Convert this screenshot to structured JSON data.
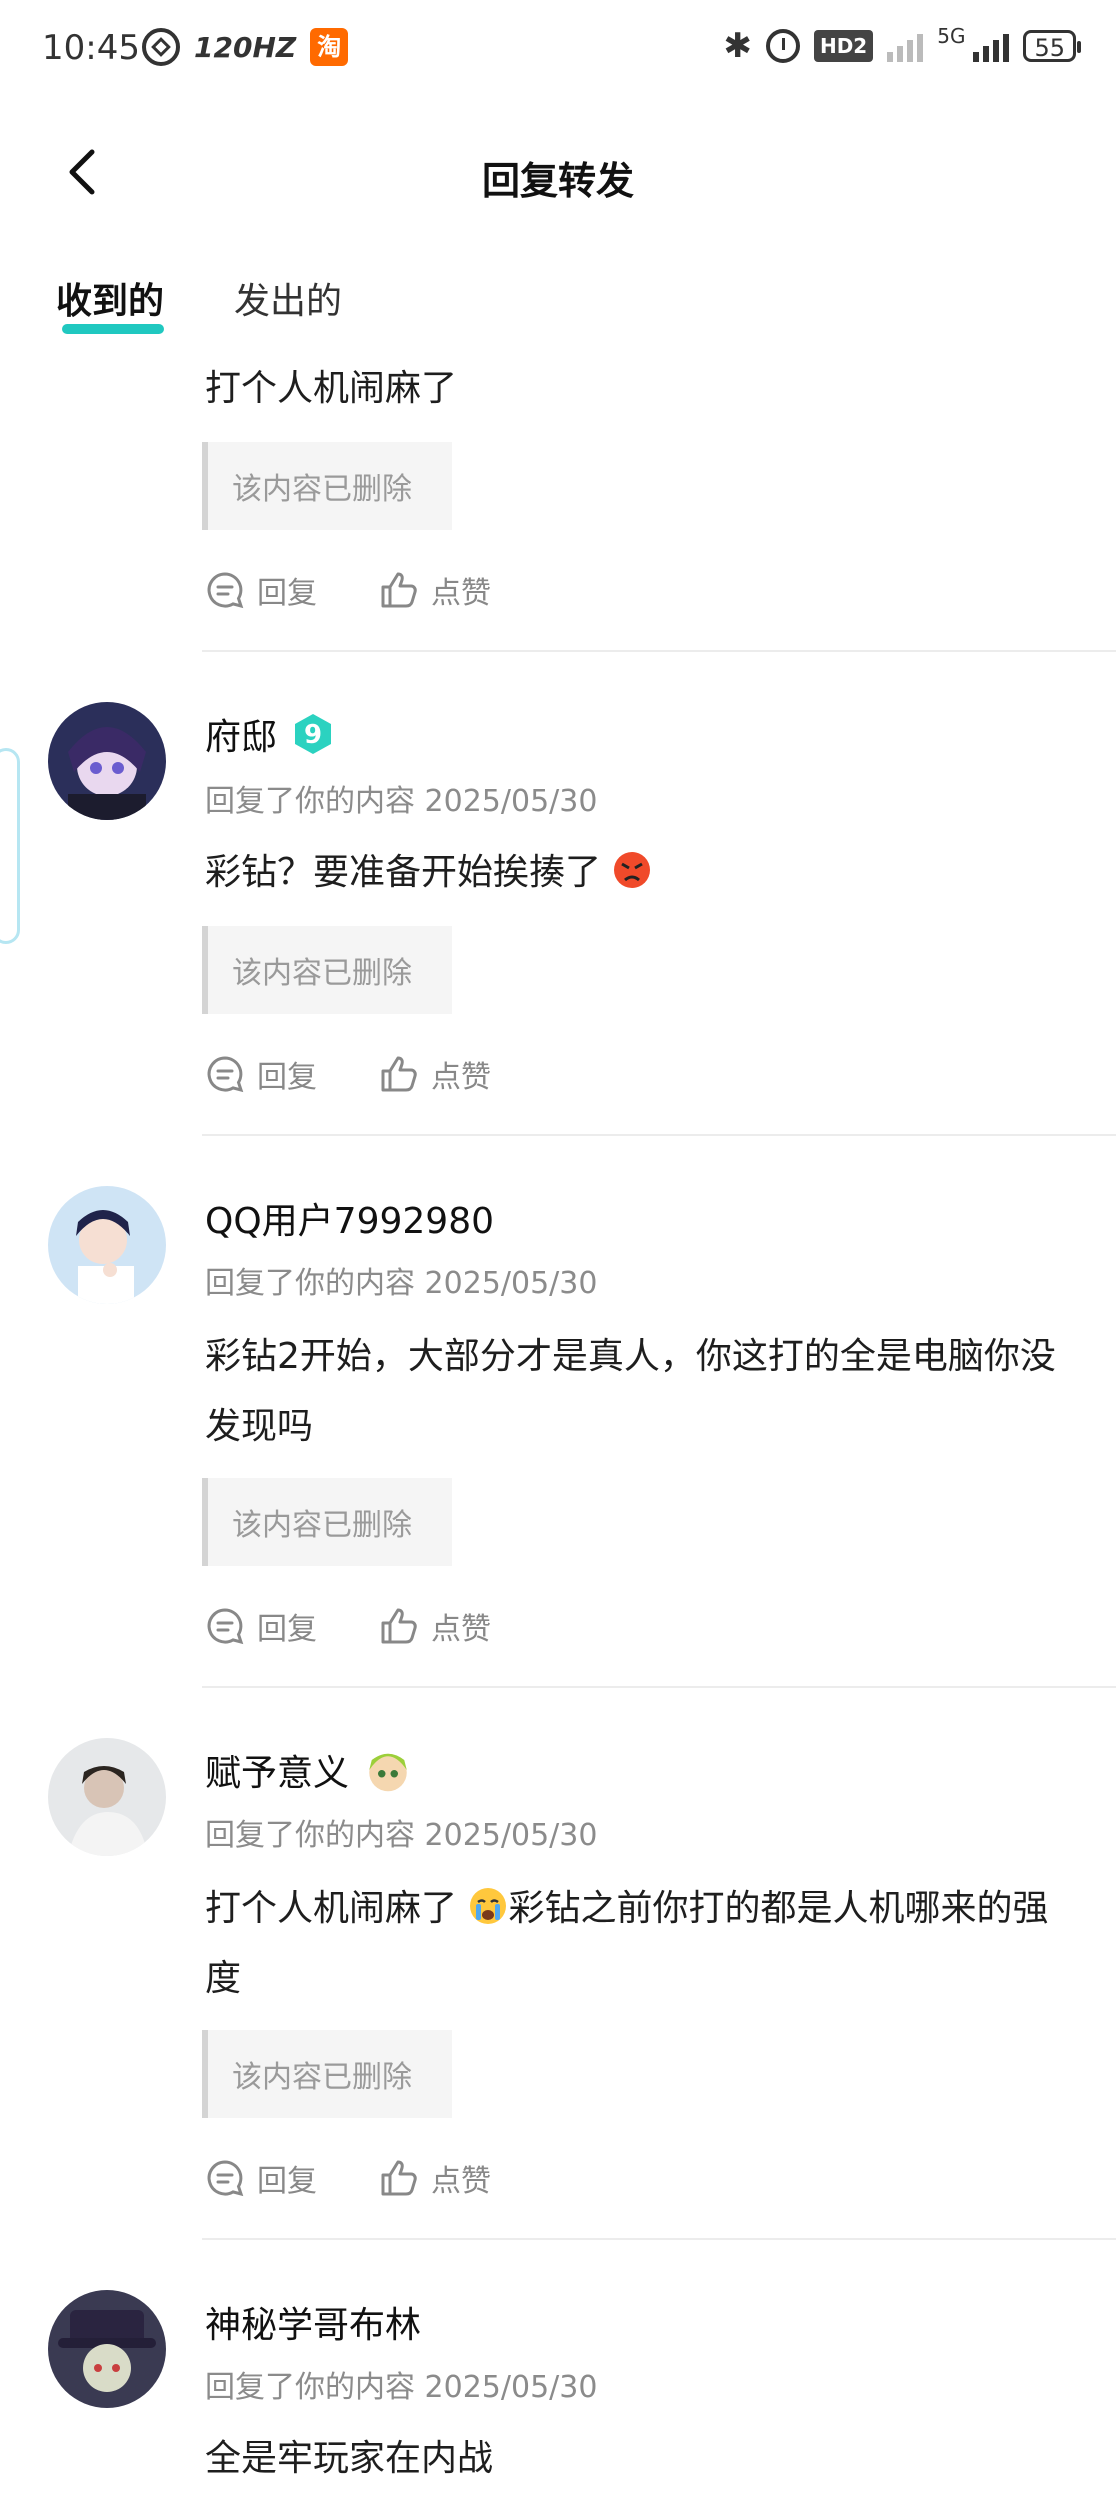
{
  "status_bar": {
    "time": "10:45",
    "refresh_rate": "120HZ",
    "taobao_icon": "淘",
    "hd_label": "HD2",
    "network": "5G",
    "battery": "55"
  },
  "header": {
    "title": "回复转发",
    "back_icon": "chevron-left-icon"
  },
  "tabs": [
    {
      "label": "收到的",
      "active": true
    },
    {
      "label": "发出的",
      "active": false
    }
  ],
  "colors": {
    "accent": "#20c8c0",
    "meta_gray": "#8b8b8b"
  },
  "actions": {
    "reply": "回复",
    "like": "点赞"
  },
  "items": [
    {
      "content": "打个人机闹麻了",
      "quote": "该内容已删除"
    },
    {
      "username": "府邸",
      "badge": "9",
      "meta": "回复了你的内容 2025/05/30",
      "content": "彩钻？要准备开始挨揍了",
      "content_emoji": "angry-face",
      "quote": "该内容已删除"
    },
    {
      "username": "QQ用户7992980",
      "meta": "回复了你的内容 2025/05/30",
      "content": "彩钻2开始，大部分才是真人，你这打的全是电脑你没发现吗",
      "quote": "该内容已删除"
    },
    {
      "username": "赋予意义",
      "username_emoji": "cartoon-character",
      "meta": "回复了你的内容 2025/05/30",
      "content_part1": "打个人机闹麻了",
      "content_emoji": "crying-face",
      "content_part2": "彩钻之前你打的都是人机哪来的强度",
      "quote": "该内容已删除"
    },
    {
      "username": "神秘学哥布林",
      "meta": "回复了你的内容 2025/05/30",
      "content": "全是牢玩家在内战"
    }
  ]
}
